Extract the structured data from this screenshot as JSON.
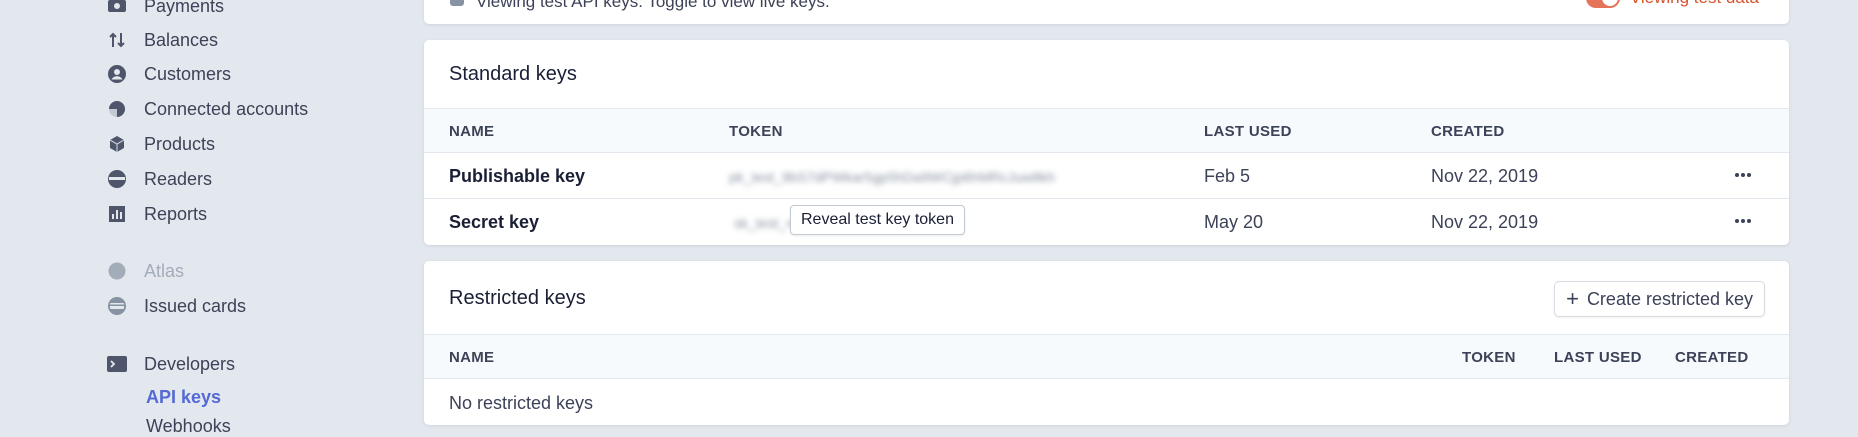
{
  "sidebar": {
    "items": [
      {
        "label": "Payments",
        "icon": "payments-icon"
      },
      {
        "label": "Balances",
        "icon": "balances-icon"
      },
      {
        "label": "Customers",
        "icon": "customers-icon"
      },
      {
        "label": "Connected accounts",
        "icon": "connected-accounts-icon"
      },
      {
        "label": "Products",
        "icon": "products-icon"
      },
      {
        "label": "Readers",
        "icon": "readers-icon"
      },
      {
        "label": "Reports",
        "icon": "reports-icon"
      },
      {
        "label": "Atlas",
        "icon": "atlas-icon",
        "disabled": true
      },
      {
        "label": "Issued cards",
        "icon": "issued-cards-icon"
      },
      {
        "label": "Developers",
        "icon": "developers-icon"
      }
    ],
    "sub_items": [
      {
        "label": "API keys",
        "active": true
      },
      {
        "label": "Webhooks"
      }
    ]
  },
  "notice": {
    "text": "Viewing test API keys. Toggle to view live keys.",
    "toggle_label": "Viewing test data"
  },
  "standard_keys": {
    "title": "Standard keys",
    "columns": [
      "NAME",
      "TOKEN",
      "LAST USED",
      "CREATED"
    ],
    "rows": [
      {
        "name": "Publishable key",
        "token": "pk_test_9bS7dPWkar5gp5hDa9WCjp6hMRcJuw8kh",
        "last_used": "Feb 5",
        "created": "Nov 22, 2019"
      },
      {
        "name": "Secret key",
        "token": "sk_test_••••••••••••••••••••••••r8Hhuv",
        "last_used": "May 20",
        "created": "Nov 22, 2019"
      }
    ],
    "reveal_label": "Reveal test key token"
  },
  "restricted_keys": {
    "title": "Restricted keys",
    "create_label": "Create restricted key",
    "columns": [
      "NAME",
      "TOKEN",
      "LAST USED",
      "CREATED"
    ],
    "empty_text": "No restricted keys"
  },
  "colors": {
    "accent": "#5469d4",
    "toggle": "#e5735a",
    "background": "#e3e8ee"
  }
}
